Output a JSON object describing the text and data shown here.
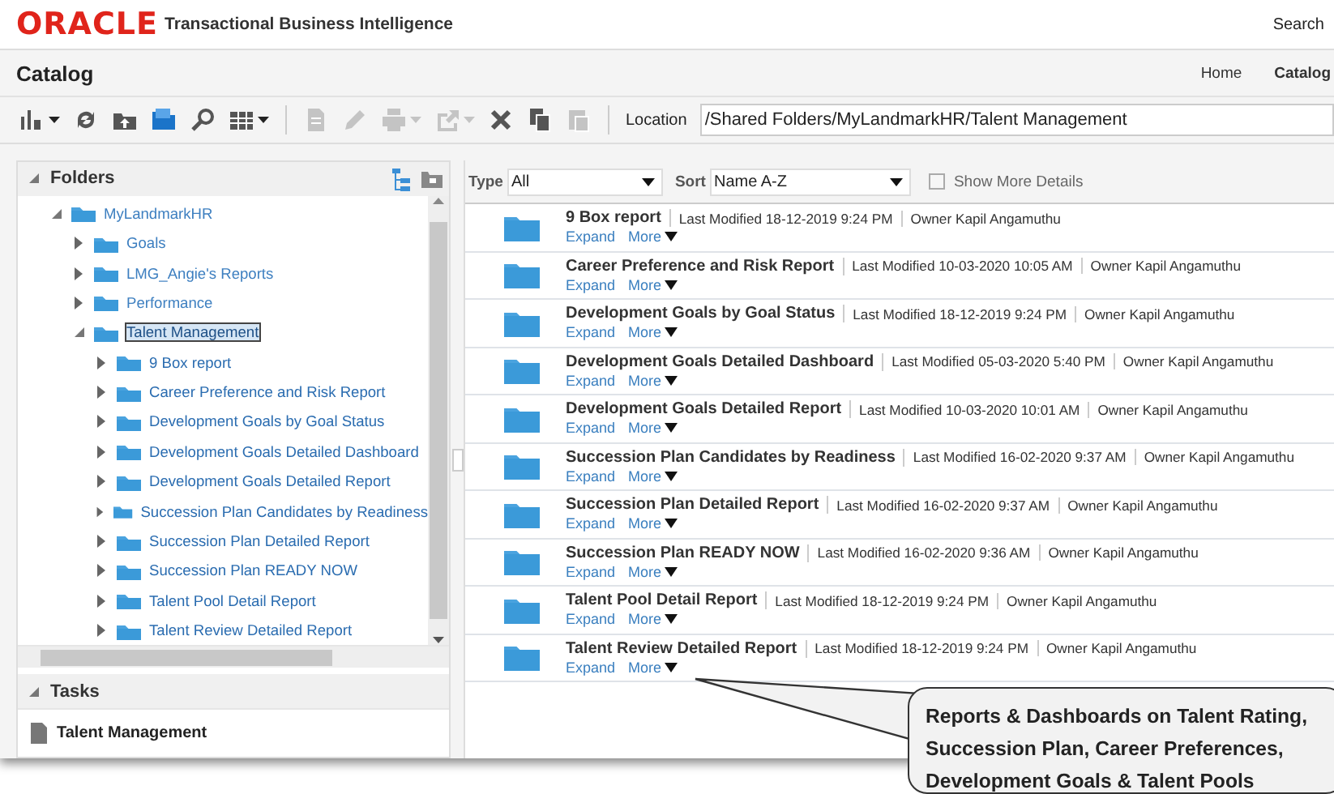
{
  "header": {
    "logo": "ORACLE",
    "product": "Transactional Business Intelligence",
    "search_label": "Search"
  },
  "page": {
    "title": "Catalog",
    "breadcrumbs": [
      {
        "label": "Home",
        "selected": false
      },
      {
        "label": "Catalog",
        "selected": true
      }
    ]
  },
  "toolbar": {
    "tools": [
      {
        "kind": "view",
        "disabled": false,
        "menu": true
      },
      {
        "kind": "refresh",
        "disabled": false,
        "menu": false
      },
      {
        "kind": "upload",
        "disabled": false,
        "menu": false
      },
      {
        "kind": "folder",
        "disabled": false,
        "menu": false
      },
      {
        "kind": "search",
        "disabled": false,
        "menu": false
      },
      {
        "kind": "grid",
        "disabled": false,
        "menu": true
      },
      {
        "kind": "sep"
      },
      {
        "kind": "copy-doc",
        "disabled": true,
        "menu": false
      },
      {
        "kind": "edit",
        "disabled": true,
        "menu": false
      },
      {
        "kind": "print",
        "disabled": true,
        "menu": true
      },
      {
        "kind": "share",
        "disabled": true,
        "menu": true
      },
      {
        "kind": "delete",
        "disabled": false,
        "menu": false
      },
      {
        "kind": "copy",
        "disabled": false,
        "menu": false
      },
      {
        "kind": "paste",
        "disabled": true,
        "menu": false
      },
      {
        "kind": "sep"
      }
    ],
    "location_label": "Location",
    "location": "/Shared Folders/MyLandmarkHR/Talent Management"
  },
  "folders": {
    "title": "Folders",
    "tree": [
      {
        "label": "MyLandmarkHR",
        "expanded": true,
        "selected": false,
        "children": [
          {
            "label": "Goals",
            "expanded": false,
            "selected": false
          },
          {
            "label": "LMG_Angie's Reports",
            "expanded": false,
            "selected": false
          },
          {
            "label": "Performance",
            "expanded": false,
            "selected": false
          },
          {
            "label": "Talent Management",
            "expanded": true,
            "selected": true,
            "children": [
              {
                "label": "9 Box report",
                "expanded": false,
                "selected": false
              },
              {
                "label": "Career Preference and Risk Report",
                "expanded": false,
                "selected": false
              },
              {
                "label": "Development Goals by Goal Status",
                "expanded": false,
                "selected": false
              },
              {
                "label": "Development Goals Detailed Dashboard",
                "expanded": false,
                "selected": false
              },
              {
                "label": "Development Goals Detailed Report",
                "expanded": false,
                "selected": false
              },
              {
                "label": "Succession Plan Candidates by Readiness",
                "expanded": false,
                "selected": false
              },
              {
                "label": "Succession Plan Detailed Report",
                "expanded": false,
                "selected": false
              },
              {
                "label": "Succession Plan READY NOW",
                "expanded": false,
                "selected": false
              },
              {
                "label": "Talent Pool Detail Report",
                "expanded": false,
                "selected": false
              },
              {
                "label": "Talent Review Detailed Report",
                "expanded": false,
                "selected": false
              }
            ]
          }
        ]
      }
    ]
  },
  "tasks": {
    "title": "Tasks",
    "items": [
      "Talent Management"
    ]
  },
  "filters": {
    "type_label": "Type",
    "type_value": "All",
    "sort_label": "Sort",
    "sort_value": "Name A-Z",
    "details": {
      "label": "Show More Details",
      "checked": false
    }
  },
  "items": [
    {
      "name": "9 Box report",
      "modified_label": "Last Modified",
      "modified": "18-12-2019 9:24 PM",
      "owner_label": "Owner",
      "owner": "Kapil Angamuthu",
      "expand": "Expand",
      "more": "More"
    },
    {
      "name": "Career Preference and Risk Report",
      "modified_label": "Last Modified",
      "modified": "10-03-2020 10:05 AM",
      "owner_label": "Owner",
      "owner": "Kapil Angamuthu",
      "expand": "Expand",
      "more": "More"
    },
    {
      "name": "Development Goals by Goal Status",
      "modified_label": "Last Modified",
      "modified": "18-12-2019 9:24 PM",
      "owner_label": "Owner",
      "owner": "Kapil Angamuthu",
      "expand": "Expand",
      "more": "More"
    },
    {
      "name": "Development Goals Detailed Dashboard",
      "modified_label": "Last Modified",
      "modified": "05-03-2020 5:40 PM",
      "owner_label": "Owner",
      "owner": "Kapil Angamuthu",
      "expand": "Expand",
      "more": "More"
    },
    {
      "name": "Development Goals Detailed Report",
      "modified_label": "Last Modified",
      "modified": "10-03-2020 10:01 AM",
      "owner_label": "Owner",
      "owner": "Kapil Angamuthu",
      "expand": "Expand",
      "more": "More"
    },
    {
      "name": "Succession Plan Candidates by Readiness",
      "modified_label": "Last Modified",
      "modified": "16-02-2020 9:37 AM",
      "owner_label": "Owner",
      "owner": "Kapil Angamuthu",
      "expand": "Expand",
      "more": "More"
    },
    {
      "name": "Succession Plan Detailed Report",
      "modified_label": "Last Modified",
      "modified": "16-02-2020 9:37 AM",
      "owner_label": "Owner",
      "owner": "Kapil Angamuthu",
      "expand": "Expand",
      "more": "More"
    },
    {
      "name": "Succession Plan READY NOW",
      "modified_label": "Last Modified",
      "modified": "16-02-2020 9:36 AM",
      "owner_label": "Owner",
      "owner": "Kapil Angamuthu",
      "expand": "Expand",
      "more": "More"
    },
    {
      "name": "Talent Pool Detail Report",
      "modified_label": "Last Modified",
      "modified": "18-12-2019 9:24 PM",
      "owner_label": "Owner",
      "owner": "Kapil Angamuthu",
      "expand": "Expand",
      "more": "More"
    },
    {
      "name": "Talent Review Detailed Report",
      "modified_label": "Last Modified",
      "modified": "18-12-2019 9:24 PM",
      "owner_label": "Owner",
      "owner": "Kapil Angamuthu",
      "expand": "Expand",
      "more": "More"
    }
  ],
  "callout": {
    "text": "Reports & Dashboards on Talent Rating, Succession Plan, Career Preferences, Development Goals & Talent Pools"
  }
}
